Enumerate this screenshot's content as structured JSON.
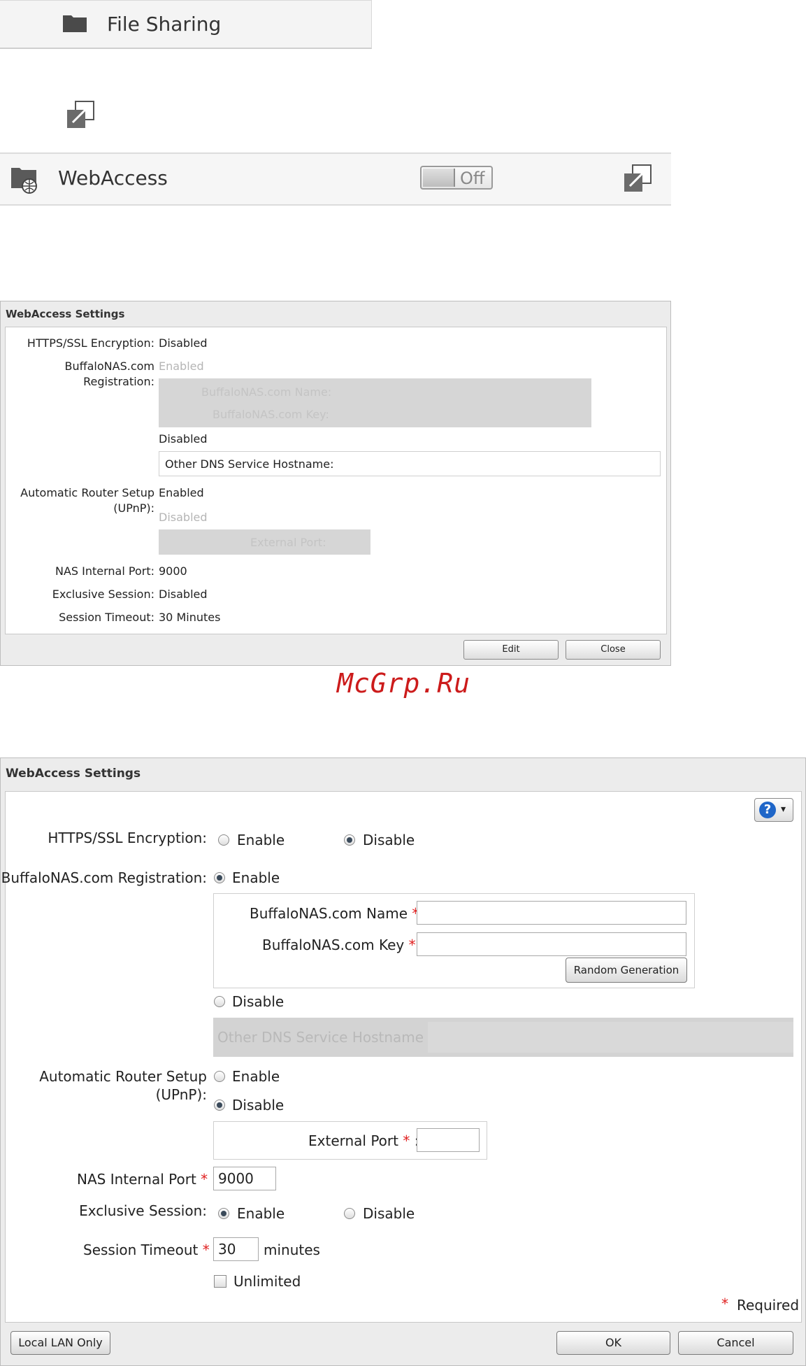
{
  "file_sharing": {
    "label": "File Sharing"
  },
  "webaccess_row": {
    "label": "WebAccess",
    "toggle_text": "Off"
  },
  "dialog_view": {
    "title": "WebAccess Settings",
    "https_label": "HTTPS/SSL Encryption:",
    "https_value": "Disabled",
    "reg_label_1": "BuffaloNAS.com",
    "reg_label_2": "Registration:",
    "reg_enabled": "Enabled",
    "name_label": "BuffaloNAS.com Name:",
    "key_label": "BuffaloNAS.com Key:",
    "reg_disabled": "Disabled",
    "other_dns": "Other DNS Service Hostname:",
    "upnp_label_1": "Automatic Router Setup",
    "upnp_label_2": "(UPnP):",
    "upnp_enabled": "Enabled",
    "upnp_disabled": "Disabled",
    "external_port": "External Port:",
    "internal_port_label": "NAS Internal Port:",
    "internal_port_value": "9000",
    "exclusive_label": "Exclusive Session:",
    "exclusive_value": "Disabled",
    "timeout_label": "Session Timeout:",
    "timeout_value": "30 Minutes",
    "edit_button": "Edit",
    "close_button": "Close"
  },
  "watermark": "McGrp.Ru",
  "dialog_edit": {
    "title": "WebAccess Settings",
    "https_label": "HTTPS/SSL Encryption:",
    "https_enable": "Enable",
    "https_disable": "Disable",
    "https_selected": "Disable",
    "reg_label": "BuffaloNAS.com Registration:",
    "reg_enable": "Enable",
    "reg_disable": "Disable",
    "reg_selected": "Enable",
    "name_label": "BuffaloNAS.com Name",
    "name_value": "",
    "key_label": "BuffaloNAS.com Key",
    "key_value": "",
    "random_button": "Random Generation",
    "other_dns_label": "Other DNS Service Hostname",
    "upnp_label_1": "Automatic Router Setup",
    "upnp_label_2": "(UPnP):",
    "upnp_enable": "Enable",
    "upnp_disable": "Disable",
    "upnp_selected": "Disable",
    "external_port_label": "External Port",
    "external_port_value": "",
    "internal_port_label": "NAS Internal Port",
    "internal_port_value": "9000",
    "exclusive_label": "Exclusive Session:",
    "exclusive_enable": "Enable",
    "exclusive_disable": "Disable",
    "exclusive_selected": "Enable",
    "timeout_label": "Session Timeout",
    "timeout_value": "30",
    "timeout_unit": "minutes",
    "unlimited_label": "Unlimited",
    "unlimited_checked": false,
    "required_star": "*",
    "colon": ":",
    "required_note": "Required",
    "local_lan_button": "Local LAN Only",
    "ok_button": "OK",
    "cancel_button": "Cancel",
    "help_symbol": "?"
  }
}
